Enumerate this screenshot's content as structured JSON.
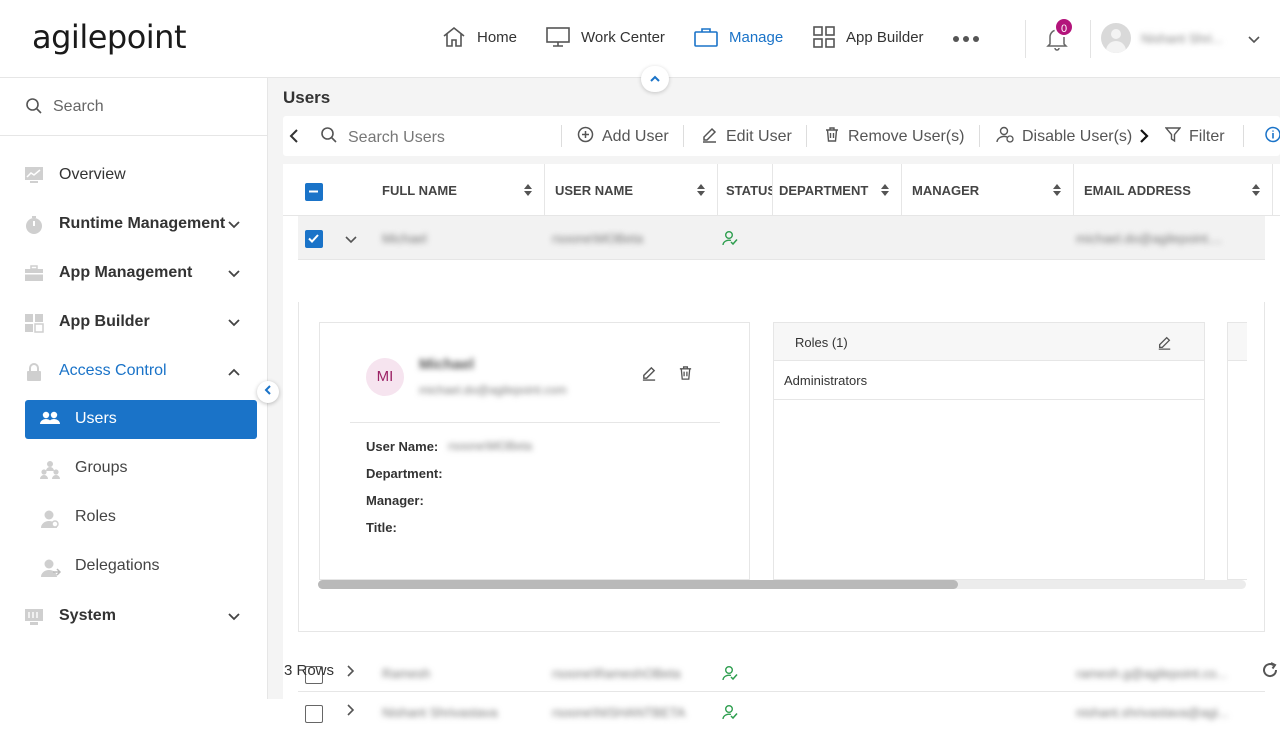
{
  "header": {
    "logo": "agilepoint",
    "nav": [
      {
        "label": "Home",
        "icon": "home-icon"
      },
      {
        "label": "Work Center",
        "icon": "monitor-icon"
      },
      {
        "label": "Manage",
        "icon": "briefcase-icon",
        "active": true
      },
      {
        "label": "App Builder",
        "icon": "grid-icon"
      }
    ],
    "notification_count": "0",
    "user_name": "Nishant Shri..."
  },
  "sidebar": {
    "search_placeholder": "Search",
    "items": [
      {
        "label": "Overview",
        "icon": "chart-icon"
      },
      {
        "label": "Runtime Management",
        "icon": "timer-icon"
      },
      {
        "label": "App Management",
        "icon": "toolbox-icon"
      },
      {
        "label": "App Builder",
        "icon": "grid-icon"
      },
      {
        "label": "Access Control",
        "icon": "lock-icon"
      },
      {
        "label": "System",
        "icon": "server-icon"
      }
    ],
    "sub_items": [
      {
        "label": "Users",
        "icon": "users-icon"
      },
      {
        "label": "Groups",
        "icon": "groups-icon"
      },
      {
        "label": "Roles",
        "icon": "role-icon"
      },
      {
        "label": "Delegations",
        "icon": "delegation-icon"
      }
    ]
  },
  "main": {
    "title": "Users",
    "toolbar": {
      "search_placeholder": "Search Users",
      "add_user": "Add User",
      "edit_user": "Edit User",
      "remove_users": "Remove User(s)",
      "disable_users": "Disable User(s)",
      "filter": "Filter"
    },
    "columns": [
      "FULL NAME",
      "USER NAME",
      "STATUS",
      "DEPARTMENT",
      "MANAGER",
      "EMAIL ADDRESS"
    ],
    "rows": [
      {
        "full_name": "Michael",
        "user_name": "rsoone\\MOBeta",
        "email": "michael.do@agilepoint....",
        "checked": true,
        "expanded": true
      },
      {
        "full_name": "Ramesh",
        "user_name": "rsoone\\RameshOBeta",
        "email": "ramesh.g@agilepoint.co...",
        "checked": false,
        "expanded": false
      },
      {
        "full_name": "Nishant Shrivastava",
        "user_name": "rsoone\\NISHANTBETA",
        "email": "nishant.shrivastava@agi...",
        "checked": false,
        "expanded": false
      }
    ],
    "detail": {
      "initials": "MI",
      "name": "Michael",
      "email": "michael.do@agilepoint.com",
      "user_name_label": "User Name:",
      "user_name_value": "rsoone\\MOBeta",
      "department_label": "Department:",
      "manager_label": "Manager:",
      "title_label": "Title:",
      "roles_title": "Roles (1)",
      "roles": [
        "Administrators"
      ]
    },
    "row_count": "3 Rows"
  },
  "colors": {
    "accent": "#1a73c8",
    "badge": "#b3147b",
    "status_ok": "#2e9e4f"
  }
}
